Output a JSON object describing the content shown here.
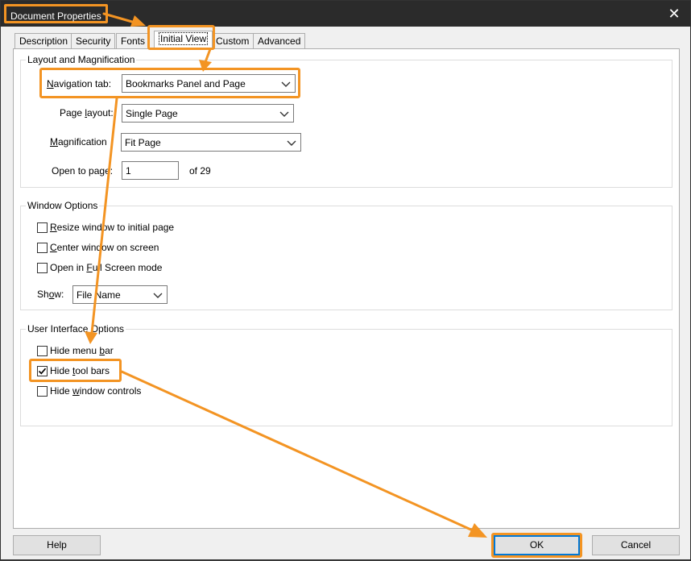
{
  "window": {
    "title": "Document Properties",
    "close_glyph": "✕"
  },
  "tabs": [
    {
      "label": "Description"
    },
    {
      "label": "Security"
    },
    {
      "label": "Fonts"
    },
    {
      "label": "Initial View",
      "active": true
    },
    {
      "label": "Custom"
    },
    {
      "label": "Advanced"
    }
  ],
  "layout_group": {
    "title": "Layout and Magnification",
    "nav_tab": {
      "label": "Navigation tab:",
      "value": "Bookmarks Panel and Page"
    },
    "page_layout": {
      "label": "Page layout:",
      "value": "Single Page"
    },
    "magnification": {
      "label": "Magnification",
      "value": "Fit Page"
    },
    "open_to_page": {
      "label": "Open to page:",
      "value": "1",
      "of_text": "of 29"
    }
  },
  "window_group": {
    "title": "Window Options",
    "options": [
      {
        "label": "Resize window to initial page",
        "checked": false
      },
      {
        "label": "Center window on screen",
        "checked": false
      },
      {
        "label": "Open in Full Screen mode",
        "checked": false
      }
    ],
    "show": {
      "label": "Show:",
      "value": "File Name"
    }
  },
  "ui_group": {
    "title": "User Interface Options",
    "options": [
      {
        "label": "Hide menu bar",
        "checked": false
      },
      {
        "label": "Hide tool bars",
        "checked": true
      },
      {
        "label": "Hide window controls",
        "checked": false
      }
    ]
  },
  "buttons": {
    "help": "Help",
    "ok": "OK",
    "cancel": "Cancel"
  },
  "colors": {
    "highlight": "#f39423",
    "titlebar": "#2b2b2b",
    "ok_border": "#0078d7"
  },
  "icons": {
    "dropdown": "chevron-down-icon",
    "check": "checkmark-icon",
    "close": "close-icon"
  }
}
